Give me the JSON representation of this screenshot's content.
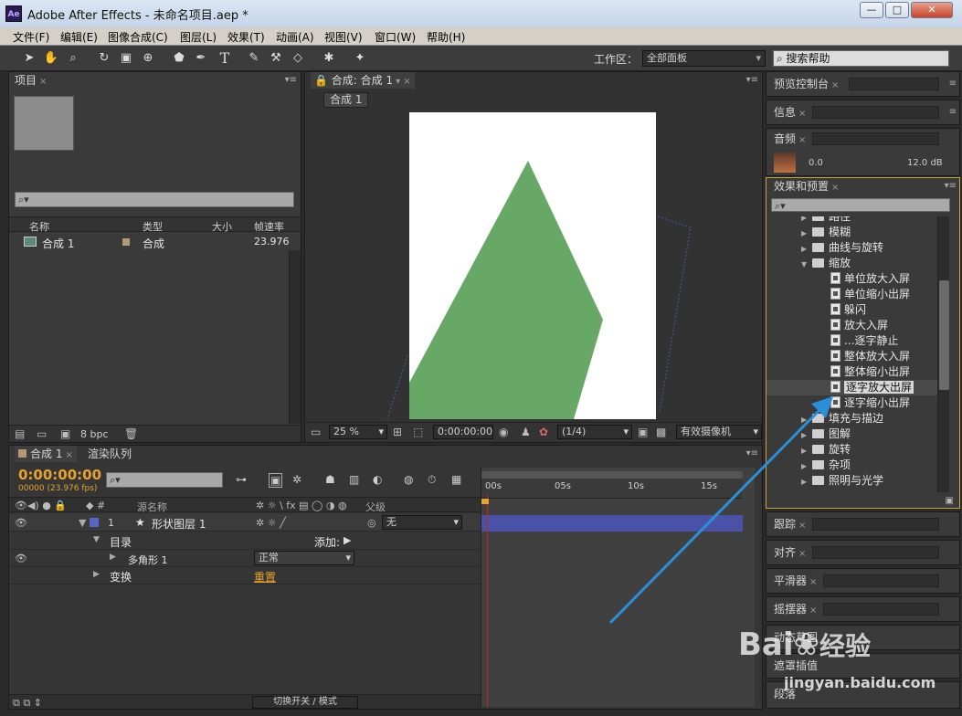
{
  "window": {
    "title": "Adobe After Effects - 未命名项目.aep *",
    "app_icon": "Ae",
    "min": "—",
    "max": "□",
    "close": "✕"
  },
  "menu": [
    "文件(F)",
    "编辑(E)",
    "图像合成(C)",
    "图层(L)",
    "效果(T)",
    "动画(A)",
    "视图(V)",
    "窗口(W)",
    "帮助(H)"
  ],
  "toolbar": {
    "workspace_label": "工作区：",
    "workspace_value": "全部面板",
    "search_help": "搜索帮助"
  },
  "project": {
    "tab": "项目",
    "search_placeholder": "⌕▾",
    "cols": [
      "名称",
      "类型",
      "大小",
      "帧速率"
    ],
    "items": [
      {
        "name": "合成 1",
        "type": "合成",
        "fps": "23.976"
      }
    ],
    "bpc": "8 bpc"
  },
  "comp": {
    "tab": "合成: 合成 1",
    "subtab": "合成 1",
    "zoom": "25 %",
    "time": "0:00:00:00",
    "resolution": "(1/4)",
    "camera": "有效摄像机"
  },
  "right": {
    "preview": "预览控制台",
    "info": "信息",
    "audio": "音频",
    "audio_left": "0.0",
    "audio_right": "12.0 dB",
    "effects": "效果和预置",
    "tracker": "跟踪",
    "align": "对齐",
    "smoother": "平滑器",
    "wiggler": "摇摆器",
    "motion": "动态草图",
    "mask": "遮罩插值",
    "brush": "段落"
  },
  "effects_tree": [
    {
      "level": 1,
      "type": "folder",
      "label": "路径"
    },
    {
      "level": 1,
      "type": "folder",
      "label": "模糊"
    },
    {
      "level": 1,
      "type": "folder",
      "label": "曲线与旋转"
    },
    {
      "level": 1,
      "type": "folder-open",
      "label": "缩放"
    },
    {
      "level": 2,
      "type": "fx",
      "label": "单位放大入屏"
    },
    {
      "level": 2,
      "type": "fx",
      "label": "单位缩小出屏"
    },
    {
      "level": 2,
      "type": "fx",
      "label": "躲闪"
    },
    {
      "level": 2,
      "type": "fx",
      "label": "放大入屏"
    },
    {
      "level": 2,
      "type": "fx",
      "label": "...逐字静止"
    },
    {
      "level": 2,
      "type": "fx",
      "label": "整体放大入屏"
    },
    {
      "level": 2,
      "type": "fx",
      "label": "整体缩小出屏"
    },
    {
      "level": 2,
      "type": "fx",
      "label": "逐字放大出屏",
      "selected": true
    },
    {
      "level": 2,
      "type": "fx",
      "label": "逐字缩小出屏"
    },
    {
      "level": 1,
      "type": "folder",
      "label": "填充与描边"
    },
    {
      "level": 1,
      "type": "folder",
      "label": "图解"
    },
    {
      "level": 1,
      "type": "folder",
      "label": "旋转"
    },
    {
      "level": 1,
      "type": "folder",
      "label": "杂项"
    },
    {
      "level": 1,
      "type": "folder",
      "label": "照明与光学"
    }
  ],
  "timeline": {
    "tab": "合成 1",
    "render_tab": "渲染队列",
    "timecode": "0:00:00:00",
    "frames": "00000 (23.976 fps)",
    "col_source": "源名称",
    "col_parent": "父级",
    "layer": {
      "num": "1",
      "name": "形状图层 1",
      "parent": "无"
    },
    "contents": "目录",
    "add": "添加:",
    "polygon": "多角形 1",
    "blend": "正常",
    "transform": "变换",
    "reset": "重置",
    "ruler": [
      "00s",
      "05s",
      "10s",
      "15s"
    ],
    "switch": "切换开关 / 模式"
  },
  "colors": {
    "shape": "#67a867",
    "highlight": "#2a8fd8",
    "layer": "#4a52a8"
  },
  "watermark": {
    "brand": "Bai",
    "brand2": "经验",
    "url": "jingyan.baidu.com"
  }
}
